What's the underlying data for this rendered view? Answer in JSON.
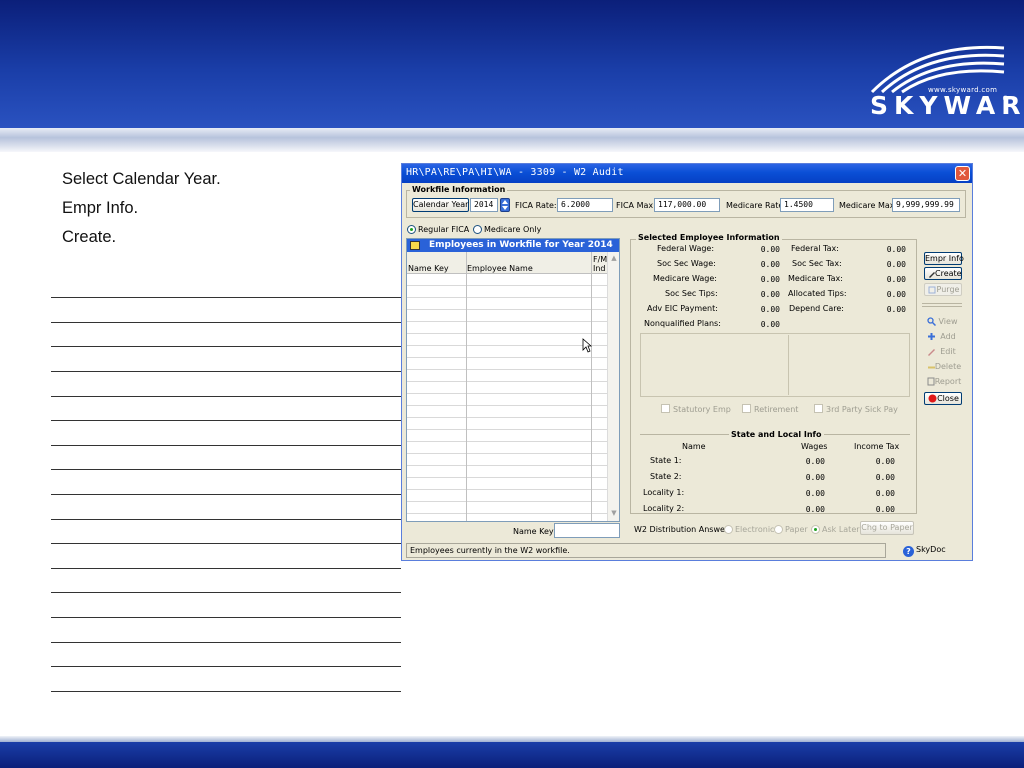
{
  "slide": {
    "logo_url": "www.skyward.com",
    "logo_word": "SKYWARD",
    "logo_reg": "®",
    "notes": [
      "Select Calendar Year.",
      "Empr Info.",
      "Create."
    ],
    "colors": {
      "banner": "#0b1f7a",
      "stripe": "#b7c3dc"
    }
  },
  "window": {
    "title": "HR\\PA\\RE\\PA\\HI\\WA - 3309 - W2 Audit",
    "close_glyph": "✕",
    "workfile": {
      "group_label": "Workfile Information",
      "calendar_year_button": "Calendar Year",
      "calendar_year_value": "2014",
      "fica_rate_label": "FICA Rate:",
      "fica_rate_value": "6.2000",
      "fica_max_label": "FICA Max:",
      "fica_max_value": "117,000.00",
      "medicare_rate_label": "Medicare Rate:",
      "medicare_rate_value": "1.4500",
      "medicare_max_label": "Medicare Max:",
      "medicare_max_value": "9,999,999.99"
    },
    "fica_options": {
      "regular": "Regular FICA",
      "medicare_only": "Medicare Only",
      "selected": "Regular FICA"
    },
    "employee_list": {
      "title": "Employees in Workfile for Year 2014",
      "columns": [
        "Name Key",
        "Employee Name",
        "F/M\nInd"
      ],
      "col_name_key": "Name Key",
      "col_employee_name": "Employee Name",
      "col_fm": "F/M",
      "col_ind": "Ind",
      "rows": [],
      "name_key_label": "Name Key:",
      "name_key_value": ""
    },
    "selected_employee": {
      "group_label": "Selected Employee Information",
      "federal_wage_label": "Federal Wage:",
      "federal_wage": "0.00",
      "federal_tax_label": "Federal Tax:",
      "federal_tax": "0.00",
      "soc_sec_wage_label": "Soc Sec Wage:",
      "soc_sec_wage": "0.00",
      "soc_sec_tax_label": "Soc Sec Tax:",
      "soc_sec_tax": "0.00",
      "medicare_wage_label": "Medicare Wage:",
      "medicare_wage": "0.00",
      "medicare_tax_label": "Medicare Tax:",
      "medicare_tax": "0.00",
      "soc_sec_tips_label": "Soc Sec Tips:",
      "soc_sec_tips": "0.00",
      "allocated_tips_label": "Allocated Tips:",
      "allocated_tips": "0.00",
      "adv_eic_label": "Adv EIC Payment:",
      "adv_eic": "0.00",
      "depend_care_label": "Depend Care:",
      "depend_care": "0.00",
      "nonqualified_label": "Nonqualified Plans:",
      "nonqualified": "0.00",
      "statutory_emp": "Statutory Emp",
      "retirement": "Retirement",
      "third_party": "3rd Party Sick Pay"
    },
    "state_local": {
      "group_label": "State and Local Info",
      "col_name": "Name",
      "col_wages": "Wages",
      "col_income_tax": "Income Tax",
      "rows": [
        {
          "label": "State 1:",
          "wages": "0.00",
          "tax": "0.00"
        },
        {
          "label": "State 2:",
          "wages": "0.00",
          "tax": "0.00"
        },
        {
          "label": "Locality 1:",
          "wages": "0.00",
          "tax": "0.00"
        },
        {
          "label": "Locality 2:",
          "wages": "0.00",
          "tax": "0.00"
        }
      ]
    },
    "w2_distribution": {
      "label": "W2 Distribution Answer:",
      "electronic": "Electronic",
      "paper": "Paper",
      "ask_later": "Ask Later",
      "selected": "Ask Later",
      "chg_button": "Chg to Paper"
    },
    "side_buttons": {
      "empr_info": "Empr Info",
      "create": "Create",
      "purge": "Purge",
      "view": "View",
      "add": "Add",
      "edit": "Edit",
      "delete": "Delete",
      "report": "Report",
      "close": "Close"
    },
    "status_text": "Employees currently in the W2 workfile.",
    "skydoc": "SkyDoc",
    "skydoc_glyph": "?"
  }
}
